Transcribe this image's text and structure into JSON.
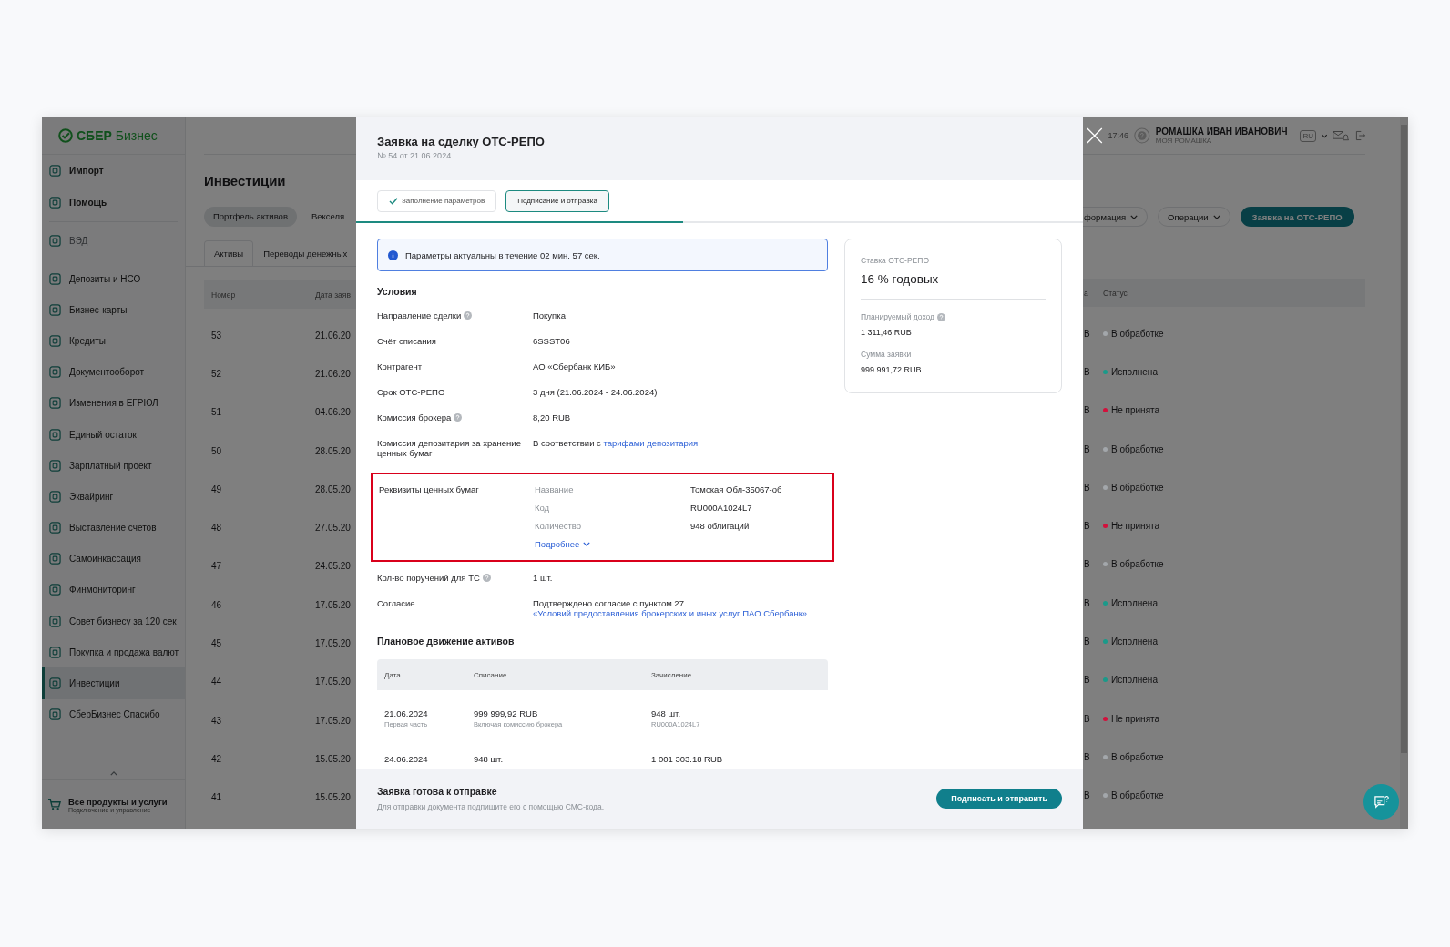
{
  "app": {
    "logo": "**СБЕР** Бизнес",
    "sidebar": {
      "top_items": [
        {
          "label": "Импорт",
          "disabled": false
        },
        {
          "label": "Помощь",
          "disabled": false
        },
        {
          "label": "ВЭД",
          "disabled": true
        }
      ],
      "items": [
        {
          "label": "Депозиты и НСО",
          "selected": false
        },
        {
          "label": "Бизнес-карты",
          "selected": false
        },
        {
          "label": "Кредиты",
          "selected": false
        },
        {
          "label": "Документооборот",
          "selected": false
        },
        {
          "label": "Изменения в ЕГРЮЛ",
          "selected": false
        },
        {
          "label": "Единый остаток",
          "selected": false
        },
        {
          "label": "Зарплатный проект",
          "selected": false
        },
        {
          "label": "Эквайринг",
          "selected": false
        },
        {
          "label": "Выставление счетов",
          "selected": false
        },
        {
          "label": "Самоинкассация",
          "selected": false
        },
        {
          "label": "Финмониторинг",
          "selected": false
        },
        {
          "label": "Совет бизнесу за 120 сек",
          "selected": false
        },
        {
          "label": "Покупка и продажа валют",
          "selected": false
        },
        {
          "label": "Инвестиции",
          "selected": true
        },
        {
          "label": "СберБизнес Спасибо",
          "selected": false
        }
      ],
      "footer": {
        "title": "Все продукты и услуги",
        "subtitle": "Подключение и управление"
      }
    },
    "header": {
      "time": "17:46",
      "user_name": "РОМАШКА ИВАН ИВАНОВИЧ",
      "company": "МОЯ РОМАШКА",
      "language": "RU"
    },
    "page": {
      "title": "Инвестиции",
      "tabs": [
        {
          "label": "Портфель активов",
          "selected": true
        },
        {
          "label": "Векселя",
          "selected": false
        }
      ],
      "subtabs": [
        {
          "label": "Активы",
          "selected": true
        },
        {
          "label": "Переводы денежных",
          "selected": false
        }
      ],
      "actions": [
        {
          "label": "формация",
          "kind": "dropdown"
        },
        {
          "label": "Операции",
          "kind": "dropdown"
        },
        {
          "label": "Заявка на ОТС-РЕПО",
          "kind": "primary"
        }
      ]
    },
    "table": {
      "columns": [
        "Номер",
        "Дата заяв",
        "а",
        "Статус"
      ],
      "rows": [
        {
          "number": "53",
          "date": "21.06.20",
          "column_3": "В",
          "status": "В обработке",
          "color": "#a3a7ab"
        },
        {
          "number": "52",
          "date": "21.06.20",
          "column_3": "В",
          "status": "Исполнена",
          "color": "#1a9a8a"
        },
        {
          "number": "51",
          "date": "04.06.20",
          "column_3": "В",
          "status": "Не принята",
          "color": "#d3103c"
        },
        {
          "number": "50",
          "date": "28.05.20",
          "column_3": "В",
          "status": "В обработке",
          "color": "#a3a7ab"
        },
        {
          "number": "49",
          "date": "28.05.20",
          "column_3": "В",
          "status": "В обработке",
          "color": "#a3a7ab"
        },
        {
          "number": "48",
          "date": "27.05.20",
          "column_3": "В",
          "status": "Не принята",
          "color": "#d3103c"
        },
        {
          "number": "47",
          "date": "24.05.20",
          "column_3": "В",
          "status": "В обработке",
          "color": "#a3a7ab"
        },
        {
          "number": "46",
          "date": "17.05.20",
          "column_3": "В",
          "status": "Исполнена",
          "color": "#1a9a8a"
        },
        {
          "number": "45",
          "date": "17.05.20",
          "column_3": "В",
          "status": "Исполнена",
          "color": "#1a9a8a"
        },
        {
          "number": "44",
          "date": "17.05.20",
          "column_3": "В",
          "status": "Исполнена",
          "color": "#1a9a8a"
        },
        {
          "number": "43",
          "date": "17.05.20",
          "column_3": "В",
          "status": "Не принята",
          "color": "#d3103c"
        },
        {
          "number": "42",
          "date": "15.05.20",
          "column_3": "В",
          "status": "В обработке",
          "color": "#a3a7ab"
        },
        {
          "number": "41",
          "date": "15.05.20",
          "column_3": "В",
          "status": "В обработке",
          "color": "#a3a7ab"
        }
      ]
    }
  },
  "modal": {
    "title": "Заявка на сделку ОТС-РЕПО",
    "subtitle": "№ 54 от 21.06.2024",
    "steps": [
      {
        "label": "Заполнение параметров",
        "done": true,
        "selected": false
      },
      {
        "label": "Подписание и отправка",
        "done": false,
        "selected": true
      }
    ],
    "progress": {
      "level": 0.45
    },
    "notice": "Параметры актуальны в течение 02 мин. 57 сек.",
    "conditions_title": "Условия",
    "details": [
      {
        "kind": "row",
        "label": "Направление сделки",
        "help": true,
        "value": "Покупка"
      },
      {
        "kind": "row",
        "label": "Счёт списания",
        "help": false,
        "value": "6SSST06"
      },
      {
        "kind": "row",
        "label": "Контрагент",
        "help": false,
        "value": "АО «Сбербанк КИБ»"
      },
      {
        "kind": "row",
        "label": "Срок ОТС-РЕПО",
        "help": false,
        "value": "3 дня (21.06.2024 - 24.06.2024)"
      },
      {
        "kind": "row",
        "label": "Комиссия брокера",
        "help": true,
        "value": "8,20 RUB"
      },
      {
        "kind": "row",
        "label": "Комиссия депозитария за хранение ценных бумаг",
        "help": false,
        "value": "В соответствии с",
        "link": "тарифами депозитария"
      },
      {
        "kind": "securities",
        "label": "Реквизиты ценных бумаг",
        "help": false,
        "highlighted": true,
        "fields": [
          {
            "label": "Название",
            "value": "Томская Обл-35067-об"
          },
          {
            "label": "Код",
            "value": "RU000A1024L7"
          },
          {
            "label": "Количество",
            "value": "948 облигаций"
          }
        ],
        "more_link": "Подробнее"
      },
      {
        "kind": "row",
        "label": "Кол-во поручений для ТС",
        "help": true,
        "value": "1 шт."
      },
      {
        "kind": "row",
        "label": "Согласие",
        "help": false,
        "value": "Подтверждено согласие с пунктом 27",
        "link": "«Условий предоставления брокерских и иных услуг ПАО Сбербанк»"
      }
    ],
    "movements": {
      "title": "Плановое движение активов",
      "columns": [
        "Дата",
        "Списание",
        "Зачисление"
      ],
      "rows": [
        {
          "date": "21.06.2024",
          "date_note": "Первая часть",
          "debit": "999 999,92 RUB",
          "debit_note": "Включая комиссию брокера",
          "credit": "948 шт.",
          "credit_note": "RU000A1024L7"
        },
        {
          "date": "24.06.2024",
          "debit": "948 шт.",
          "credit": "1 001 303.18 RUB"
        }
      ]
    },
    "summary": {
      "rate_label": "Ставка ОТС-РЕПО",
      "rate": "16 % годовых",
      "items": [
        {
          "label": "Планируемый доход",
          "help": true,
          "value": "1 311,46 RUB"
        },
        {
          "label": "Сумма заявки",
          "help": false,
          "value": "999 991,72 RUB"
        }
      ]
    },
    "footer": {
      "title": "Заявка готова к отправке",
      "text": "Для отправки документа подпишите его с помощью СМС-кода.",
      "button": "Подписать и отправить"
    }
  }
}
